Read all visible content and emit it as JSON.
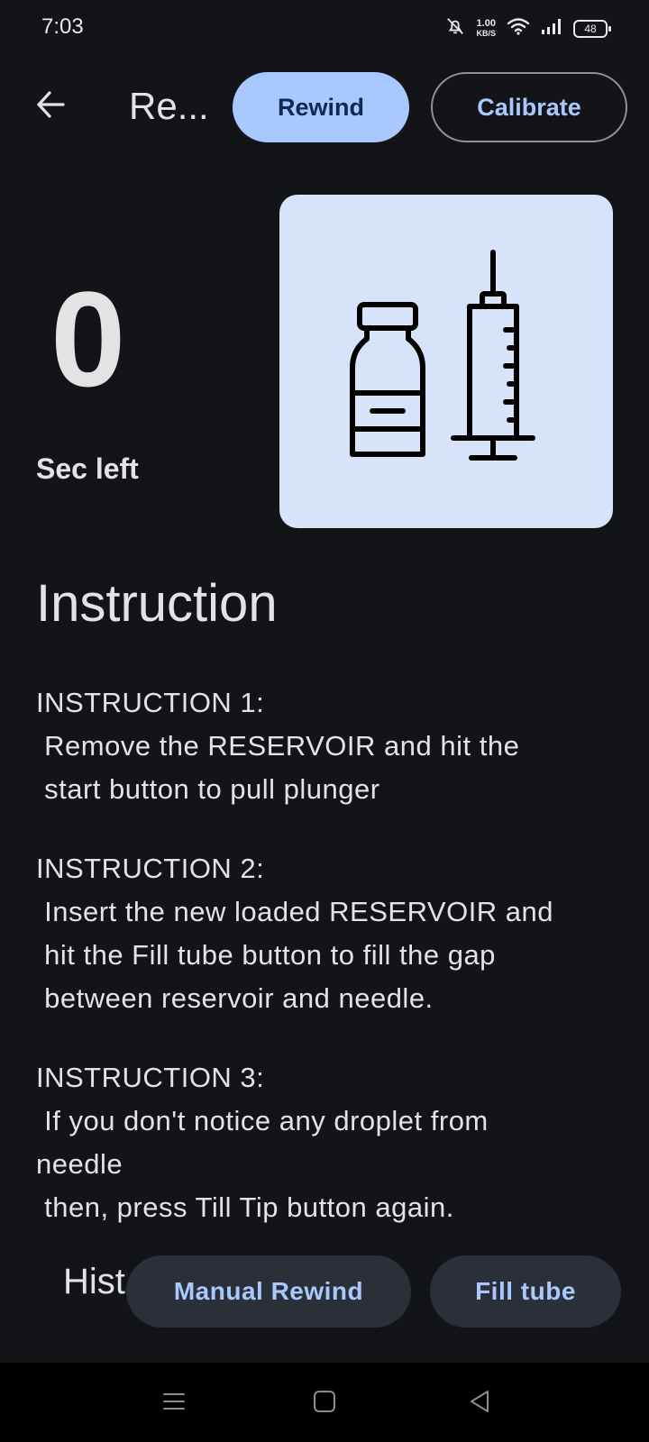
{
  "status_bar": {
    "time": "7:03",
    "net_speed_value": "1.00",
    "net_speed_unit": "KB/S",
    "battery": "48",
    "icons": [
      "bell-off-icon",
      "wifi-icon",
      "signal-icon",
      "battery-icon"
    ]
  },
  "top_bar": {
    "title": "Re...",
    "rewind_label": "Rewind",
    "calibrate_label": "Calibrate"
  },
  "countdown": {
    "value": "0",
    "label": "Sec left"
  },
  "illustration": {
    "icons": [
      "vial-icon",
      "syringe-icon"
    ]
  },
  "instructions": {
    "title": "Instruction",
    "items": [
      {
        "heading": "INSTRUCTION 1:",
        "body": " Remove the RESERVOIR and hit the\n start button to pull plunger"
      },
      {
        "heading": "INSTRUCTION 2:",
        "body": " Insert the new loaded RESERVOIR and\n hit the Fill tube button to fill the gap\n between reservoir and needle."
      },
      {
        "heading": "INSTRUCTION 3:",
        "body": " If you don't notice any droplet from\nneedle\n then, press Till Tip button again."
      }
    ]
  },
  "history": {
    "label": "Hist"
  },
  "actions": {
    "manual_rewind_label": "Manual Rewind",
    "fill_tube_label": "Fill tube"
  },
  "colors": {
    "background": "#121418",
    "primary": "#a8c8ff",
    "card": "#d6e3f8",
    "pill": "#2b2f37"
  }
}
